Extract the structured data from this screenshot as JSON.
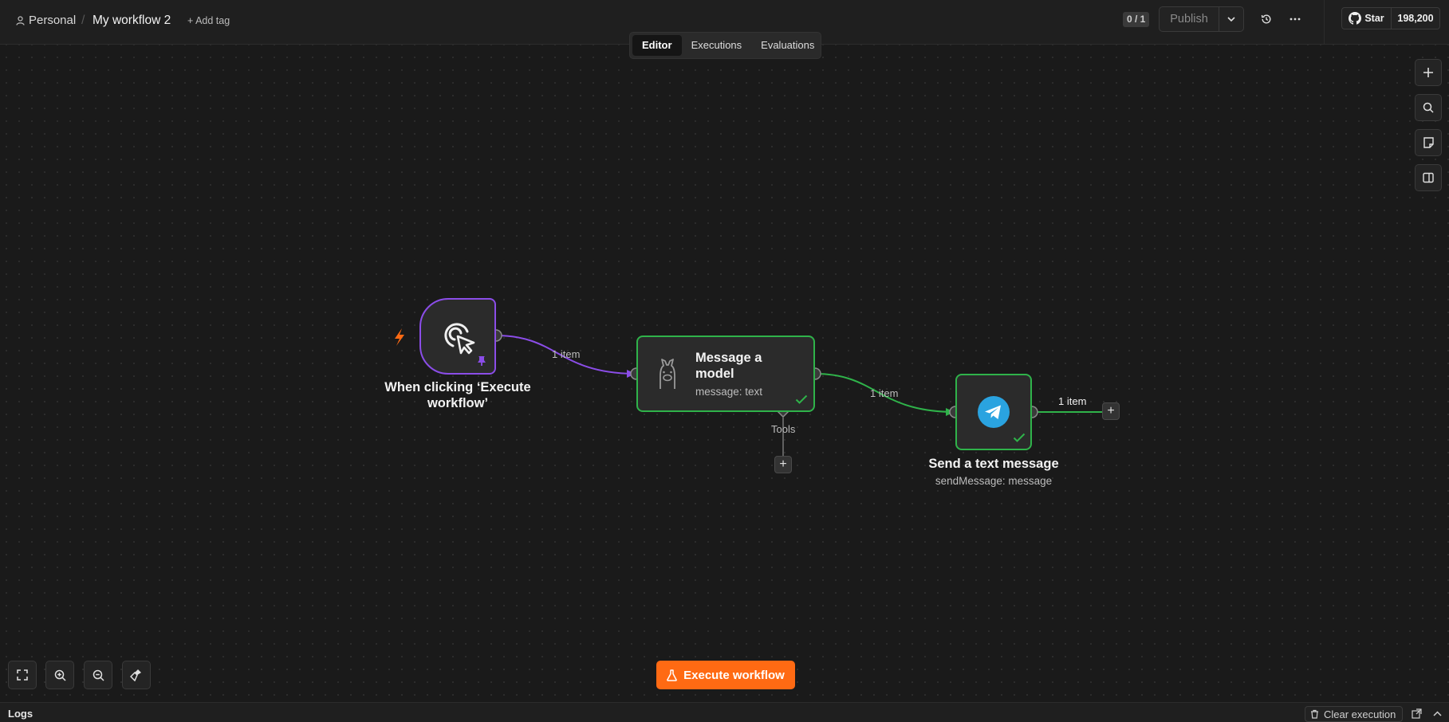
{
  "header": {
    "breadcrumb_project": "Personal",
    "breadcrumb_separator": "/",
    "workflow_title": "My workflow 2",
    "add_tag_label": "+ Add tag",
    "version_badge": "0 / 1",
    "publish_label": "Publish",
    "github_star_label": "Star",
    "github_star_count": "198,200"
  },
  "tabs": [
    {
      "label": "Editor",
      "active": true
    },
    {
      "label": "Executions",
      "active": false
    },
    {
      "label": "Evaluations",
      "active": false
    }
  ],
  "nodes": {
    "trigger": {
      "title": "When clicking ‘Execute workflow’",
      "icon": "cursor-click-icon"
    },
    "model": {
      "title": "Message a model",
      "subtitle": "message: text",
      "icon": "ollama-llama-icon",
      "tools_label": "Tools"
    },
    "telegram": {
      "title": "Send a text message",
      "subtitle": "sendMessage: message",
      "icon": "telegram-icon"
    }
  },
  "connections": {
    "trigger_to_model": "1 item",
    "model_to_telegram": "1 item",
    "telegram_output": "1 item"
  },
  "execute_button_label": "Execute workflow",
  "logs": {
    "title": "Logs",
    "clear_label": "Clear execution"
  },
  "colors": {
    "trigger_border": "#8b4de8",
    "success": "#2fb34a",
    "accent": "#ff6a13",
    "telegram": "#2aa3e0"
  }
}
